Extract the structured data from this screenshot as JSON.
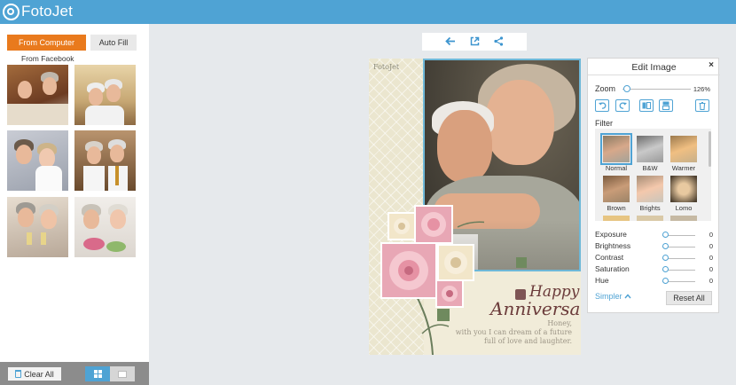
{
  "header": {
    "logo_text": "FotoJet"
  },
  "sidebar": {
    "from_computer": "From Computer",
    "auto_fill": "Auto Fill",
    "from_facebook": "From Facebook",
    "photos": [
      {
        "icon": "photo-thumbnail-icon"
      },
      {
        "icon": "photo-thumbnail-icon"
      },
      {
        "icon": "photo-thumbnail-icon"
      },
      {
        "icon": "photo-thumbnail-icon"
      },
      {
        "icon": "photo-thumbnail-icon"
      },
      {
        "icon": "photo-thumbnail-icon"
      }
    ]
  },
  "bottom": {
    "clear_all": "Clear All"
  },
  "toolbar": {
    "icons": [
      "back-arrow-icon",
      "open-icon",
      "share-icon"
    ]
  },
  "card": {
    "brand": "FotoJet",
    "title_line1": "Happy",
    "title_line2": "Anniversary",
    "message": [
      "Honey,",
      "with you I can dream of a future",
      "full of love and laughter."
    ]
  },
  "edit_panel": {
    "title": "Edit Image",
    "close": "×",
    "zoom_label": "Zoom",
    "zoom_value": "126%",
    "filter_label": "Filter",
    "filters": [
      "Normal",
      "B&W",
      "Warmer",
      "Brown",
      "Brights",
      "Lomo"
    ],
    "selected_filter": "Normal",
    "adjustments": [
      {
        "label": "Exposure",
        "value": "0"
      },
      {
        "label": "Brightness",
        "value": "0"
      },
      {
        "label": "Contrast",
        "value": "0"
      },
      {
        "label": "Saturation",
        "value": "0"
      },
      {
        "label": "Hue",
        "value": "0"
      }
    ],
    "simpler": "Simpler",
    "reset_all": "Reset All"
  },
  "colors": {
    "accent": "#4fa3d4",
    "orange": "#e97a1d",
    "header": "#4fa3d4"
  }
}
